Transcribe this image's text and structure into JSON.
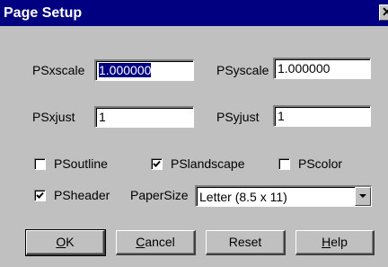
{
  "window": {
    "title": "Page Setup",
    "close_glyph": "✕"
  },
  "fields": {
    "psxscale": {
      "label": "PSxscale",
      "value": "1.000000"
    },
    "psyscale": {
      "label": "PSyscale",
      "value": "1.000000"
    },
    "psxjust": {
      "label": "PSxjust",
      "value": "1"
    },
    "psyjust": {
      "label": "PSyjust",
      "value": "1"
    }
  },
  "checkboxes": {
    "psoutline": {
      "label": "PSoutline",
      "checked": false
    },
    "pslandscape": {
      "label": "PSlandscape",
      "checked": true
    },
    "pscolor": {
      "label": "PScolor",
      "checked": false
    },
    "psheader": {
      "label": "PSheader",
      "checked": true
    }
  },
  "papersize": {
    "label": "PaperSize",
    "value": "Letter (8.5 x 11)"
  },
  "buttons": {
    "ok": {
      "mnemonic": "O",
      "rest": "K"
    },
    "cancel": {
      "mnemonic": "C",
      "rest": "ancel"
    },
    "reset": {
      "label": "Reset"
    },
    "help": {
      "mnemonic": "H",
      "rest": "elp"
    }
  },
  "icons": {
    "close": "close-icon",
    "check": "check-icon",
    "dropdown": "chevron-down-icon"
  }
}
